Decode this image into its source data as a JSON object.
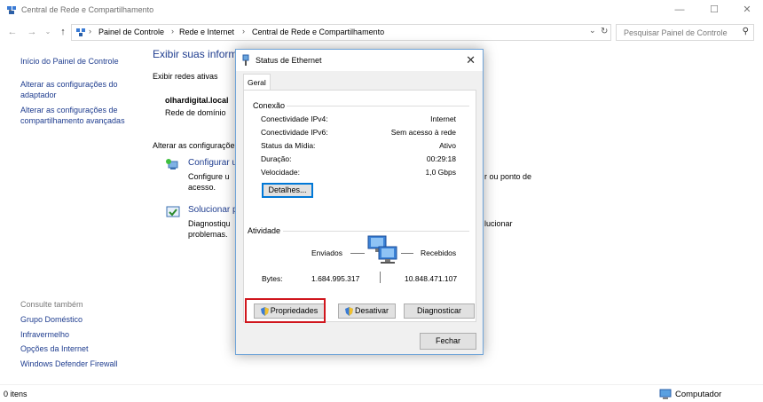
{
  "window": {
    "title": "Central de Rede e Compartilhamento",
    "controls": {
      "minimize": "—",
      "maximize": "☐",
      "close": "✕"
    }
  },
  "address": {
    "crumbs": [
      "Painel de Controle",
      "Rede e Internet",
      "Central de Rede e Compartilhamento"
    ],
    "search_placeholder": "Pesquisar Painel de Controle"
  },
  "sidebar": {
    "links": [
      "Início do Painel de Controle",
      "Alterar as configurações do adaptador",
      "Alterar as configurações de compartilhamento avançadas"
    ],
    "see_also_label": "Consulte também",
    "see_also": [
      "Grupo Doméstico",
      "Infravermelho",
      "Opções da Internet",
      "Windows Defender Firewall"
    ]
  },
  "main": {
    "heading": "Exibir suas inform",
    "active_networks_label": "Exibir redes ativas",
    "network_name": "olhardigital.local",
    "network_type": "Rede de domínio",
    "change_settings_label": "Alterar as configuraçõe",
    "task1_link": "Configurar u",
    "task1_desc_a": "Configure u",
    "task1_desc_a_right": "r ou ponto de",
    "task1_desc_b": "acesso.",
    "task2_link": "Solucionar pr",
    "task2_desc_a": "Diagnostiqu",
    "task2_desc_a_right": "lucionar",
    "task2_desc_b": "problemas."
  },
  "statusbar": {
    "items_count": "0 itens",
    "computer_label": "Computador"
  },
  "dialog": {
    "title": "Status de Ethernet",
    "tab": "Geral",
    "connection": {
      "label": "Conexão",
      "rows": [
        {
          "k": "Conectividade IPv4:",
          "v": "Internet"
        },
        {
          "k": "Conectividade IPv6:",
          "v": "Sem acesso à rede"
        },
        {
          "k": "Status da Mídia:",
          "v": "Ativo"
        },
        {
          "k": "Duração:",
          "v": "00:29:18"
        },
        {
          "k": "Velocidade:",
          "v": "1,0 Gbps"
        }
      ],
      "details_button": "Detalhes..."
    },
    "activity": {
      "label": "Atividade",
      "sent_label": "Enviados",
      "received_label": "Recebidos",
      "bytes_label": "Bytes:",
      "bytes_sent": "1.684.995.317",
      "bytes_received": "10.848.471.107"
    },
    "buttons": {
      "properties": "Propriedades",
      "disable": "Desativar",
      "diagnose": "Diagnosticar",
      "close": "Fechar"
    }
  },
  "colors": {
    "link": "#1f3d8f",
    "highlight": "#d0161d",
    "dialog_border": "#6fa4d8"
  }
}
